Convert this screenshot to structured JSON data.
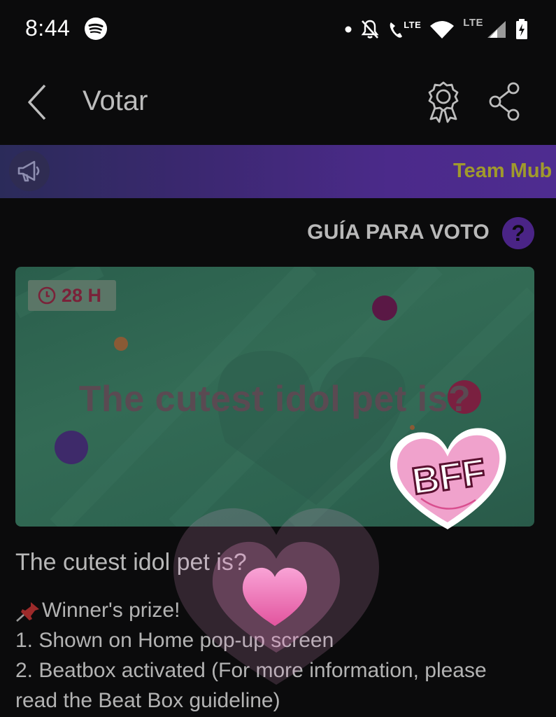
{
  "status_bar": {
    "time": "8:44",
    "lte_label_1": "LTE",
    "lte_label_2": "LTE"
  },
  "header": {
    "title": "Votar",
    "back_icon": "chevron-left-icon",
    "award_icon": "award-ribbon-icon",
    "share_icon": "share-icon"
  },
  "banner": {
    "icon": "megaphone-icon",
    "text": "Team Mub",
    "color": "#4b2a8a"
  },
  "vote_guide": {
    "label": "GUÍA PARA VOTO",
    "help": "?"
  },
  "vote_card": {
    "timer": "28 H",
    "title": "The cutest idol pet is?",
    "sticker_text": "BFF",
    "background": "#336b55"
  },
  "description": {
    "title": "The cutest idol pet is?",
    "lines": [
      "Winner's prize!",
      "1. Shown on Home pop-up screen",
      "2. Beatbox activated (For more information, please",
      "read the Beat Box guideline)"
    ]
  }
}
